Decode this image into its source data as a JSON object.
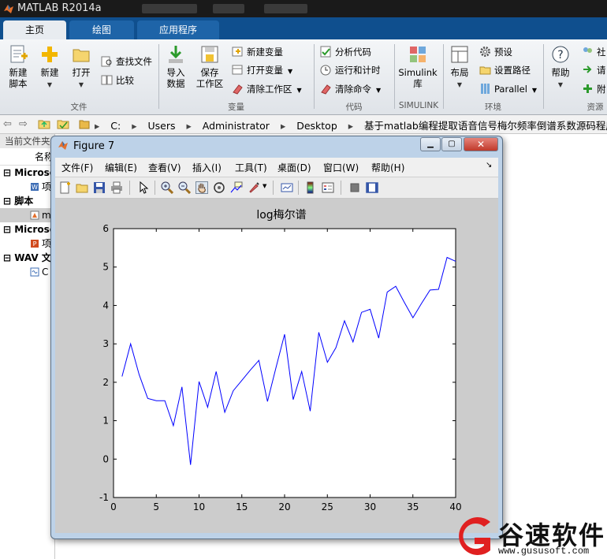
{
  "window": {
    "title": "MATLAB R2014a"
  },
  "ribbon": {
    "tabs": [
      {
        "label": "主页",
        "active": true
      },
      {
        "label": "绘图",
        "active": false
      },
      {
        "label": "应用程序",
        "active": false
      }
    ],
    "file_group": {
      "label": "文件",
      "new_script": "新建\n脚本",
      "new": "新建",
      "open": "打开",
      "find_files": "查找文件",
      "compare": "比较"
    },
    "variable_group": {
      "label": "变量",
      "import_data": "导入\n数据",
      "save_workspace": "保存\n工作区",
      "new_variable": "新建变量",
      "open_variable": "打开变量",
      "clear_workspace": "清除工作区"
    },
    "code_group": {
      "label": "代码",
      "analyze_code": "分析代码",
      "run_and_time": "运行和计时",
      "clear_commands": "清除命令"
    },
    "simulink_group": {
      "label": "SIMULINK",
      "library": "Simulink\n库"
    },
    "environment_group": {
      "label": "环境",
      "layout": "布局",
      "preferences": "预设",
      "set_path": "设置路径",
      "parallel": "Parallel"
    },
    "resources_group": {
      "label": "资源",
      "help": "帮助",
      "community": "社",
      "request": "请",
      "addons": "附"
    }
  },
  "address_bar": {
    "crumbs": [
      "C:",
      "Users",
      "Administrator",
      "Desktop",
      "基于matlab编程提取语音信号梅尔频率倒谱系数源码程序"
    ]
  },
  "file_panel": {
    "title": "当前文件夹",
    "column_name": "名称",
    "groups": [
      {
        "label": "Microso",
        "items": [
          {
            "label": "项"
          }
        ]
      },
      {
        "label": "脚本",
        "items": [
          {
            "label": "m",
            "selected": true
          }
        ]
      },
      {
        "label": "Microso",
        "items": [
          {
            "label": "项"
          }
        ]
      },
      {
        "label": "WAV 文",
        "items": [
          {
            "label": "C"
          }
        ]
      }
    ]
  },
  "figure": {
    "title": "Figure 7",
    "menu": [
      "文件(F)",
      "编辑(E)",
      "查看(V)",
      "插入(I)",
      "工具(T)",
      "桌面(D)",
      "窗口(W)",
      "帮助(H)"
    ],
    "toolbar_icons": [
      "new-figure-icon",
      "open-file-icon",
      "save-icon",
      "print-icon",
      "select-arrow-icon",
      "zoom-in-icon",
      "zoom-out-icon",
      "pan-hand-icon",
      "rotate-3d-icon",
      "data-cursor-icon",
      "brush-icon",
      "link-plot-icon",
      "colorbar-icon",
      "legend-icon",
      "hide-plot-tools-icon",
      "show-plot-tools-icon"
    ]
  },
  "chart_data": {
    "type": "line",
    "title": "log梅尔谱",
    "xlabel": "",
    "ylabel": "",
    "xlim": [
      0,
      40
    ],
    "ylim": [
      -1,
      6
    ],
    "xticks": [
      0,
      5,
      10,
      15,
      20,
      25,
      30,
      35,
      40
    ],
    "yticks": [
      -1,
      0,
      1,
      2,
      3,
      4,
      5,
      6
    ],
    "grid": false,
    "series": [
      {
        "color": "#0000ff",
        "x": [
          1,
          2,
          3,
          4,
          5,
          6,
          7,
          8,
          9,
          10,
          11,
          12,
          13,
          14,
          15,
          16,
          17,
          18,
          19,
          20,
          21,
          22,
          23,
          24,
          25,
          26,
          27,
          28,
          29,
          30,
          31,
          32,
          33,
          34,
          35,
          36,
          37,
          38,
          39,
          40
        ],
        "values": [
          2.15,
          3.0,
          2.2,
          1.58,
          1.52,
          1.52,
          0.87,
          1.88,
          -0.15,
          2.02,
          1.35,
          2.28,
          1.22,
          1.78,
          2.05,
          2.32,
          2.57,
          1.5,
          2.38,
          3.25,
          1.55,
          2.28,
          1.25,
          3.3,
          2.52,
          2.9,
          3.6,
          3.05,
          3.82,
          3.9,
          3.15,
          4.35,
          4.5,
          4.08,
          3.68,
          4.05,
          4.4,
          4.42,
          5.25,
          5.15
        ]
      }
    ]
  },
  "watermark": {
    "brand": "谷速软件",
    "url": "www.gususoft.com"
  },
  "colors": {
    "ribbon_tab_bg": "#0f4f8e",
    "plot_line": "#0000ff",
    "titlebar": "#1a1a1a"
  }
}
